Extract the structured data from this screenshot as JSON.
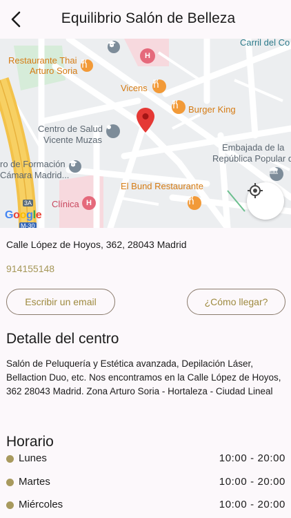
{
  "header": {
    "title": "Equilibrio Salón de Belleza",
    "back_icon": "chevron-left-icon"
  },
  "map": {
    "labels": {
      "carril": "Carril del Co",
      "thai_1": "Restaurante Thai",
      "thai_2": "Arturo Soria",
      "vicens": "Vicens",
      "burger_king": "Burger King",
      "centro_salud_1": "Centro de Salud",
      "centro_salud_2": "Vicente Muzas",
      "embajada_1": "Embajada de la",
      "embajada_2": "República Popular de...",
      "formacion_1": "ro de Formación",
      "formacion_2": "Cámara Madrid...",
      "el_bund": "El Bund Restaurante",
      "clinica": "Clínica",
      "road_3a": "3A",
      "road_m30": "M-30",
      "google": "Google"
    },
    "icons": {
      "hospital": "H",
      "marker": "map-marker-icon"
    },
    "colors": {
      "accent_orange": "#f29a38",
      "pin_red": "#e53935",
      "hospital_red": "#e5697b",
      "highway_yellow": "#f7d063"
    }
  },
  "address": "Calle López de Hoyos, 362, 28043 Madrid",
  "phone": "914155148",
  "buttons": {
    "email": "Escribir un email",
    "route": "¿Cómo llegar?"
  },
  "detail": {
    "title": "Detalle del centro",
    "text": "Salón de Peluquería y Estética avanzada, Depilación Láser, Bellaction Duo, etc. Nos encontramos en la Calle López de Hoyos, 362 28043 Madrid. Zona Arturo Soria - Hortaleza - Ciudad Lineal"
  },
  "schedule": {
    "title": "Horario",
    "rows": [
      {
        "day": "Lunes",
        "hours": "10:00 - 20:00"
      },
      {
        "day": "Martes",
        "hours": "10:00 - 20:00"
      },
      {
        "day": "Miércoles",
        "hours": "10:00 - 20:00"
      }
    ]
  },
  "theme": {
    "gold": "#a89a5e",
    "background": "#fcf8fb"
  }
}
